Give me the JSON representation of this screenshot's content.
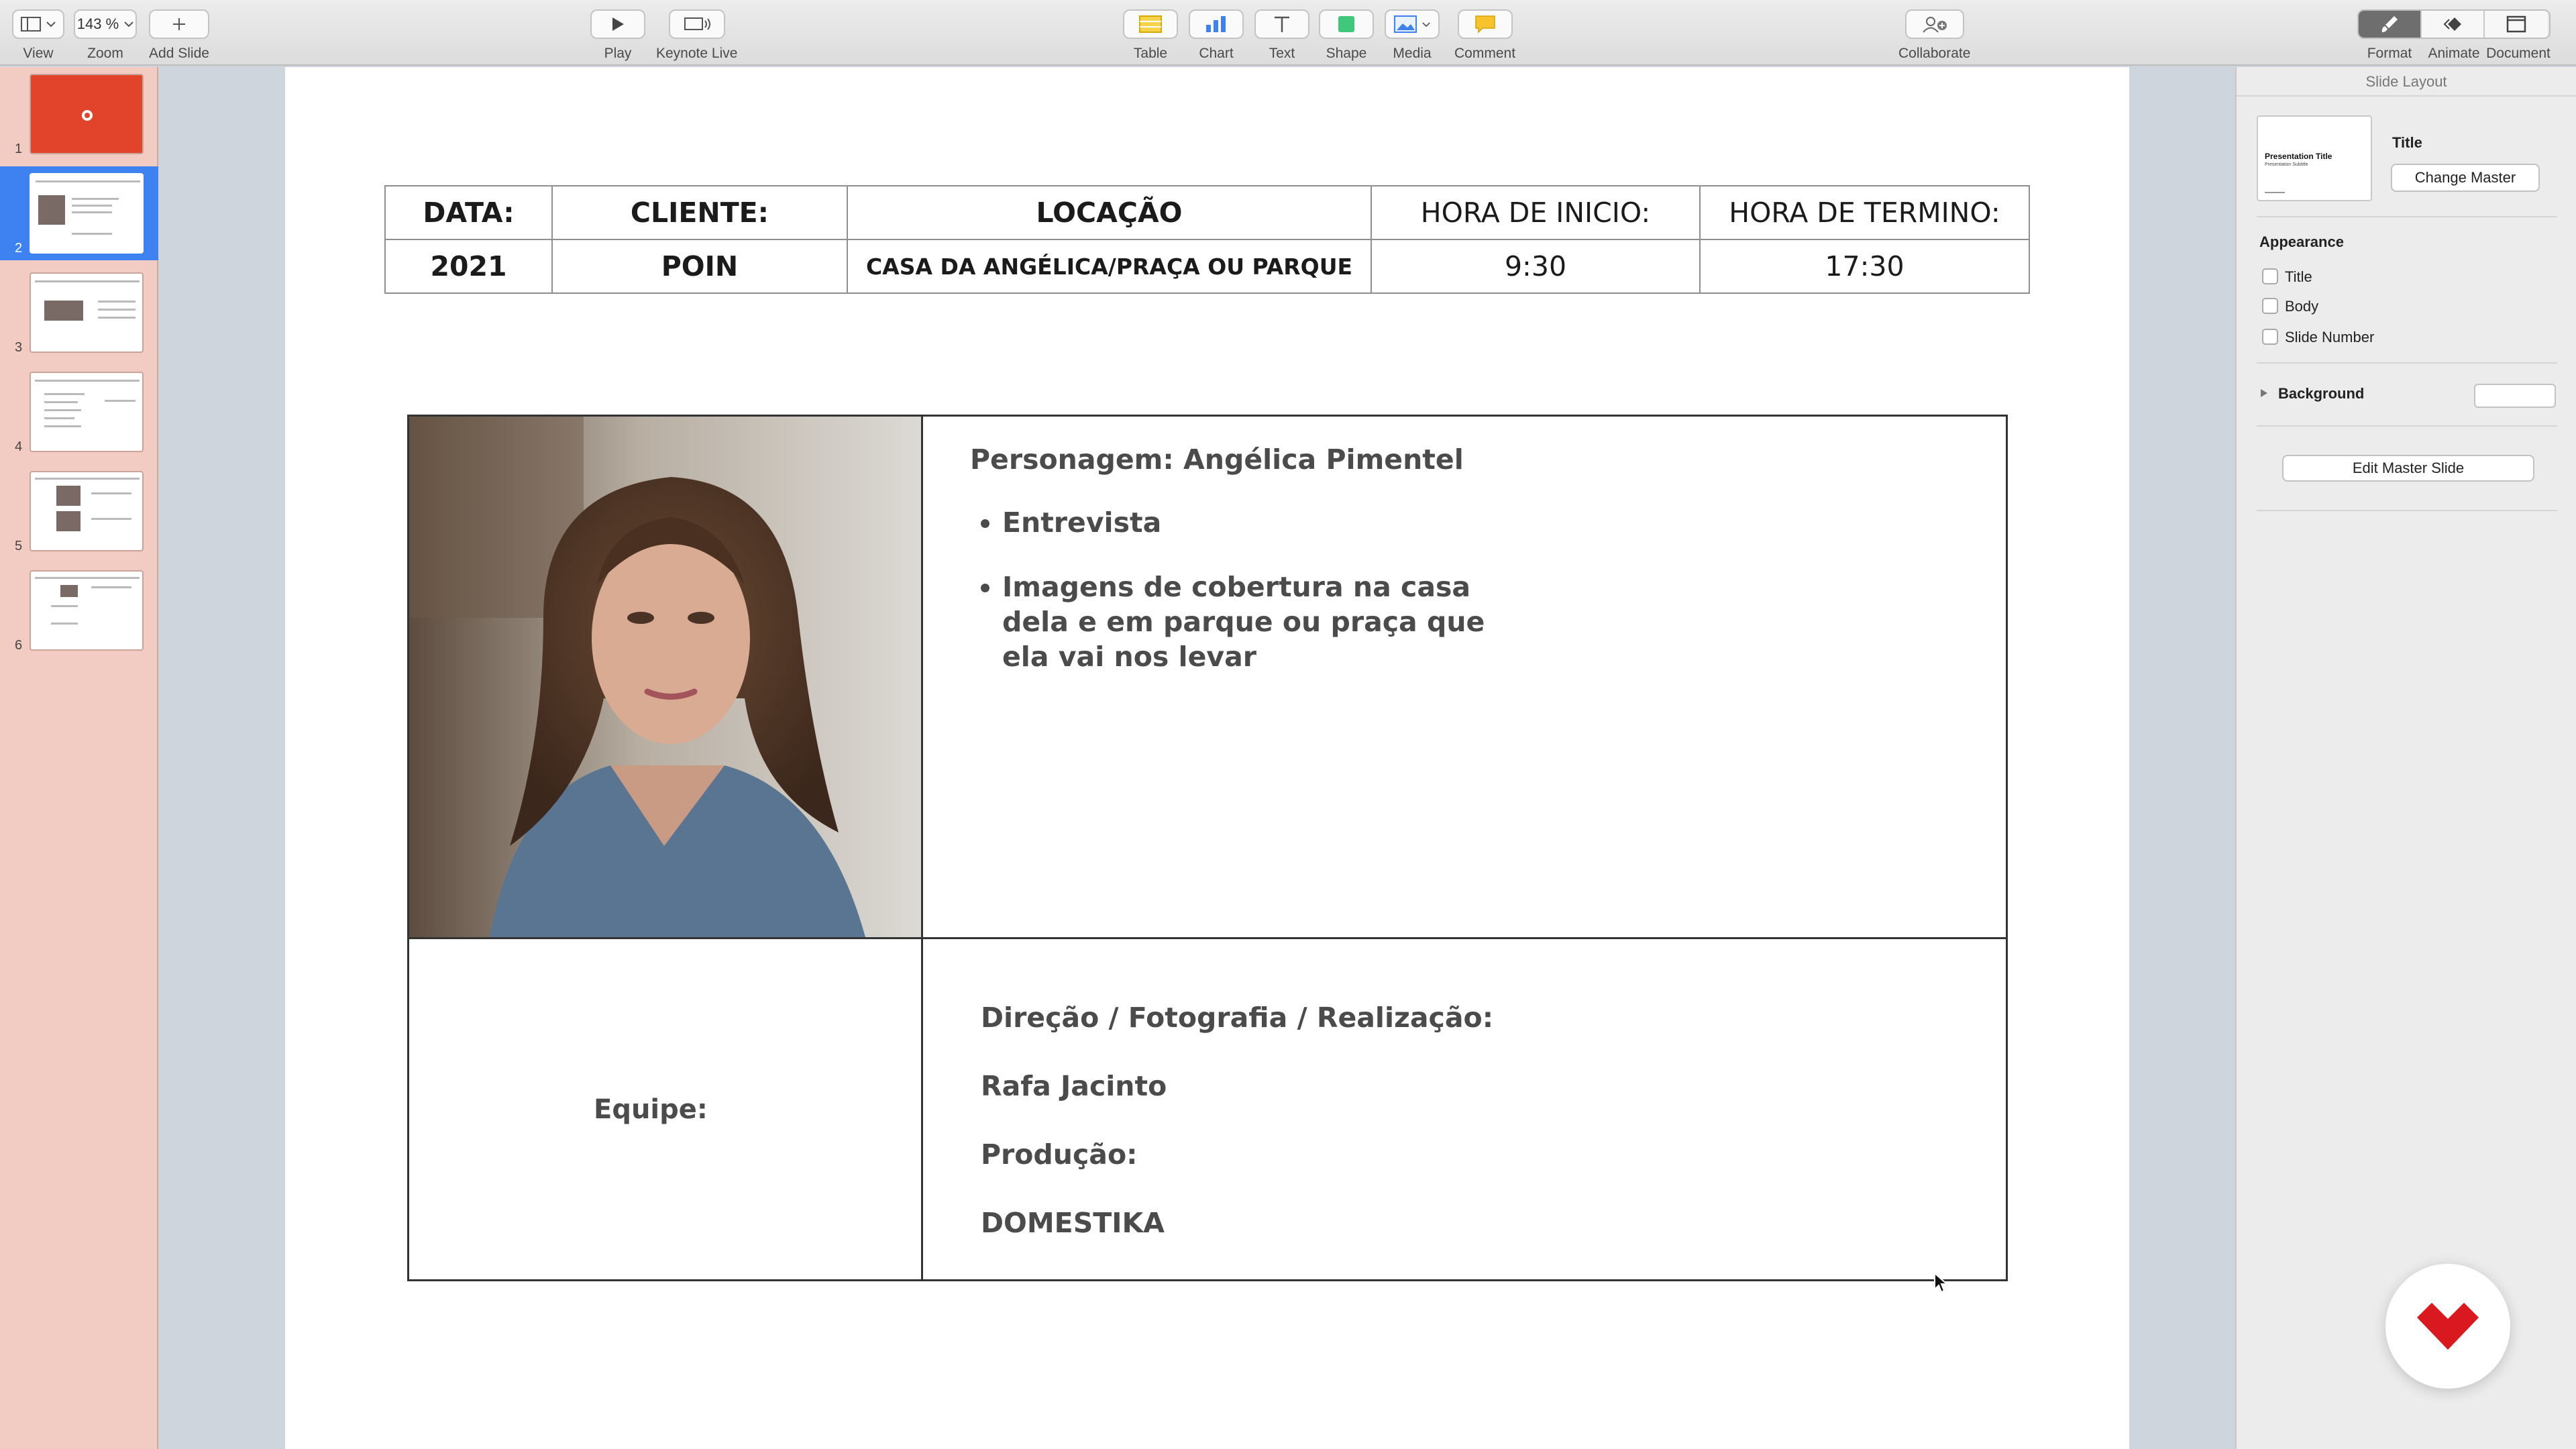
{
  "toolbar": {
    "zoom_value": "143 %",
    "items": {
      "view": "View",
      "zoom": "Zoom",
      "add_slide": "Add Slide",
      "play": "Play",
      "keynote_live": "Keynote Live",
      "table": "Table",
      "chart": "Chart",
      "text": "Text",
      "shape": "Shape",
      "media": "Media",
      "comment": "Comment",
      "collaborate": "Collaborate",
      "format": "Format",
      "animate": "Animate",
      "document": "Document"
    }
  },
  "navigator": {
    "selected_slide": 2,
    "slides": [
      "1",
      "2",
      "3",
      "4",
      "5",
      "6"
    ]
  },
  "slide": {
    "info_headers": [
      "DATA:",
      "CLIENTE:",
      "LOCAÇÃO",
      "HORA DE INICIO:",
      "HORA DE TERMINO:"
    ],
    "info_values": [
      "2021",
      "POIN",
      "CASA DA ANGÉLICA/PRAÇA OU PARQUE",
      "9:30",
      "17:30"
    ],
    "character": "Personagem: Angélica Pimentel",
    "bullets": [
      "Entrevista",
      "Imagens de cobertura na casa dela e em parque ou praça que ela vai nos levar"
    ],
    "team_label": "Equipe:",
    "team_lines": [
      "Direção / Fotografia / Realização:",
      "Rafa Jacinto",
      "Produção:",
      "DOMESTIKA"
    ]
  },
  "inspector": {
    "header": "Slide Layout",
    "master_name": "Title",
    "thumb_title": "Presentation Title",
    "thumb_subtitle": "Presentation Subtitle",
    "change_master": "Change Master",
    "appearance": "Appearance",
    "options": [
      "Title",
      "Body",
      "Slide Number"
    ],
    "background": "Background",
    "edit_master": "Edit Master Slide"
  },
  "colors": {
    "accent": "#3d82f0",
    "navigator_bg": "#f2cbc2",
    "title_slide_red": "#e2442b",
    "logo_red": "#d9181f"
  }
}
